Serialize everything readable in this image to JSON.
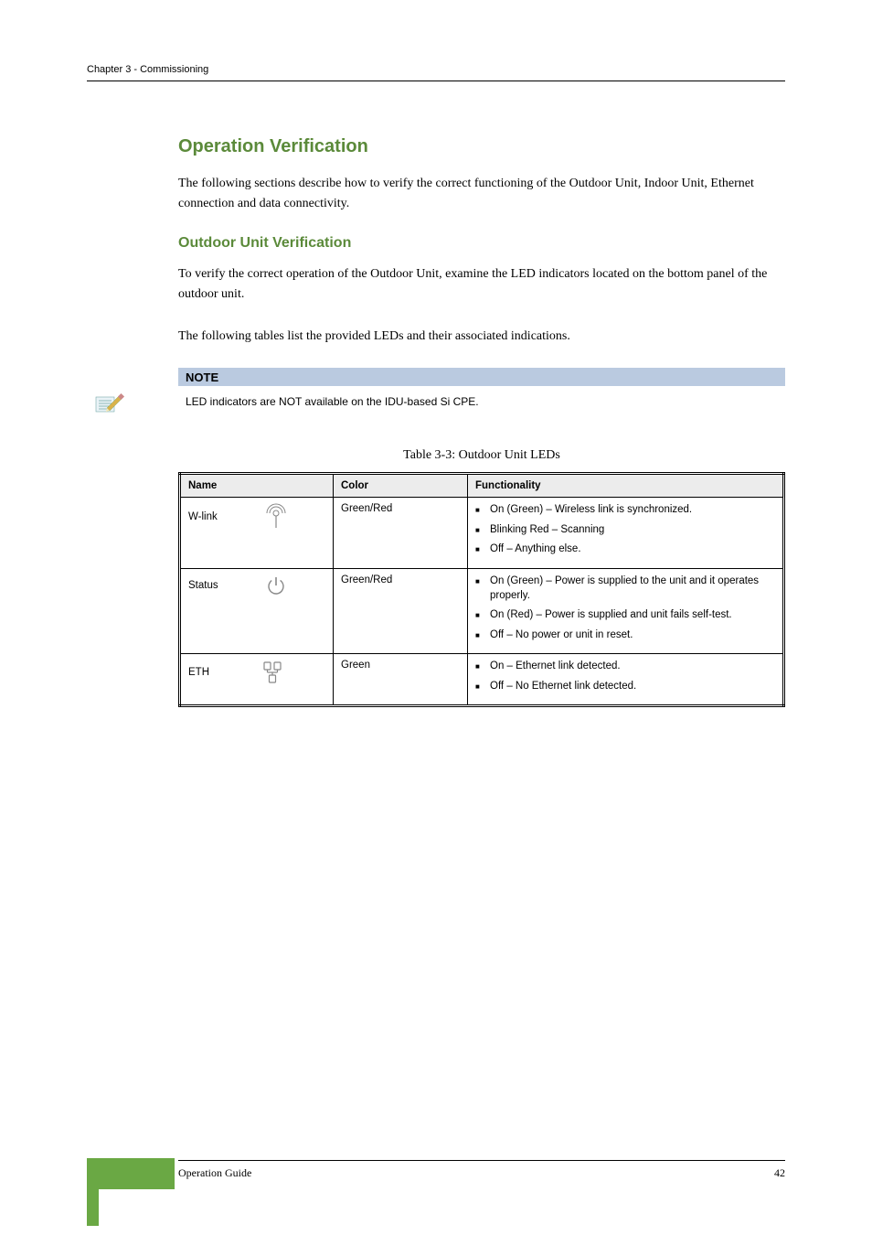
{
  "header": {
    "chapter_title": "Chapter 3 - Commissioning"
  },
  "section": {
    "h1": "Operation Verification",
    "intro": "The following sections describe how to verify the correct functioning of the Outdoor Unit, Indoor Unit, Ethernet connection and data connectivity.",
    "h2": "Outdoor Unit Verification",
    "p1": "To verify the correct operation of the Outdoor Unit, examine the LED indicators located on the bottom panel of the outdoor unit.",
    "p2": "The following tables list the provided LEDs and their associated indications."
  },
  "note": {
    "title": "NOTE",
    "text": "LED indicators are NOT available on the IDU-based Si CPE."
  },
  "table": {
    "caption": "Table 3-3: Outdoor Unit LEDs",
    "headers": {
      "name": "Name",
      "color": "Color",
      "func": "Functionality"
    },
    "rows": [
      {
        "name": "W-link",
        "icon": "antenna-icon",
        "color": "Green/Red",
        "items": [
          "On (Green) – Wireless link is synchronized.",
          "Blinking Red – Scanning",
          "Off – Anything else."
        ]
      },
      {
        "name": "Status",
        "icon": "power-icon",
        "color": "Green/Red",
        "items": [
          "On (Green) – Power is supplied to the unit and it operates properly.",
          "On (Red) – Power is supplied and unit fails self-test.",
          "Off – No power or unit in reset."
        ]
      },
      {
        "name": "ETH",
        "icon": "ethernet-icon",
        "color": "Green",
        "items": [
          "On – Ethernet link detected.",
          "Off – No Ethernet link detected."
        ]
      }
    ]
  },
  "footer": {
    "left": "Operation Guide",
    "right": "42"
  }
}
